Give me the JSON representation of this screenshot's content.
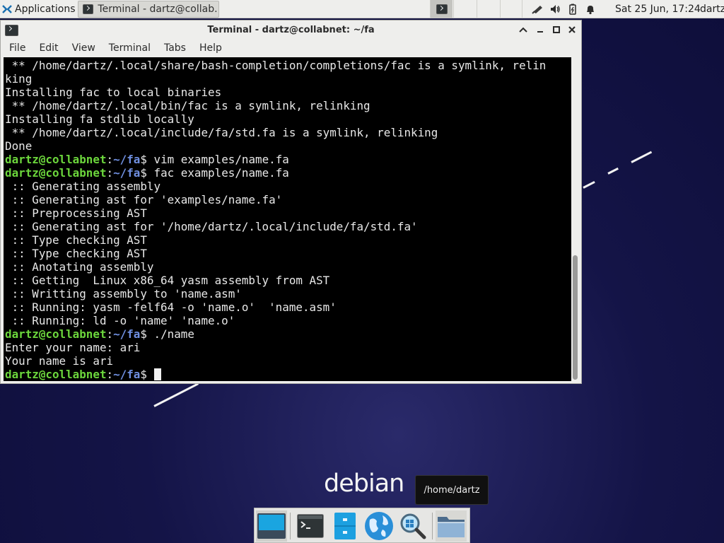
{
  "top_panel": {
    "applications_label": "Applications",
    "task_terminal_label": "Terminal - dartz@collab...",
    "clock": "Sat 25 Jun, 17:24",
    "user": "dartz",
    "tray_icons": [
      "network-icon",
      "volume-icon",
      "battery-icon",
      "notification-bell-icon"
    ]
  },
  "window": {
    "title": "Terminal - dartz@collabnet: ~/fa",
    "menu": [
      "File",
      "Edit",
      "View",
      "Terminal",
      "Tabs",
      "Help"
    ]
  },
  "terminal": {
    "user_host": "dartz@collabnet",
    "path": "~/fa",
    "lines": [
      {
        "type": "out",
        "text": " ** /home/dartz/.local/share/bash-completion/completions/fac is a symlink, relin"
      },
      {
        "type": "out",
        "text": "king"
      },
      {
        "type": "out",
        "text": "Installing fac to local binaries"
      },
      {
        "type": "out",
        "text": " ** /home/dartz/.local/bin/fac is a symlink, relinking"
      },
      {
        "type": "out",
        "text": "Installing fa stdlib locally"
      },
      {
        "type": "out",
        "text": " ** /home/dartz/.local/include/fa/std.fa is a symlink, relinking"
      },
      {
        "type": "out",
        "text": "Done"
      },
      {
        "type": "prompt",
        "text": " vim examples/name.fa"
      },
      {
        "type": "prompt",
        "text": " fac examples/name.fa"
      },
      {
        "type": "out",
        "text": " :: Generating assembly"
      },
      {
        "type": "out",
        "text": " :: Generating ast for 'examples/name.fa'"
      },
      {
        "type": "out",
        "text": " :: Preprocessing AST"
      },
      {
        "type": "out",
        "text": " :: Generating ast for '/home/dartz/.local/include/fa/std.fa'"
      },
      {
        "type": "out",
        "text": " :: Type checking AST"
      },
      {
        "type": "out",
        "text": " :: Type checking AST"
      },
      {
        "type": "out",
        "text": " :: Anotating assembly"
      },
      {
        "type": "out",
        "text": " :: Getting  Linux x86_64 yasm assembly from AST"
      },
      {
        "type": "out",
        "text": " :: Writting assembly to 'name.asm'"
      },
      {
        "type": "out",
        "text": " :: Running: yasm -felf64 -o 'name.o'  'name.asm'"
      },
      {
        "type": "out",
        "text": " :: Running: ld -o 'name' 'name.o'"
      },
      {
        "type": "prompt",
        "text": " ./name"
      },
      {
        "type": "out",
        "text": "Enter your name: ari"
      },
      {
        "type": "out",
        "text": "Your name is ari"
      },
      {
        "type": "prompt-cursor",
        "text": " "
      }
    ]
  },
  "desktop": {
    "logo": "debian",
    "tooltip": "/home/dartz"
  },
  "dock": {
    "items": [
      "show-desktop-icon",
      "terminal-icon",
      "file-manager-icon",
      "web-browser-icon",
      "app-finder-icon",
      "home-folder-icon"
    ]
  },
  "colors": {
    "prompt_user": "#6cd63c",
    "prompt_path": "#6f8fe0",
    "desktop_bg": "#141447"
  }
}
